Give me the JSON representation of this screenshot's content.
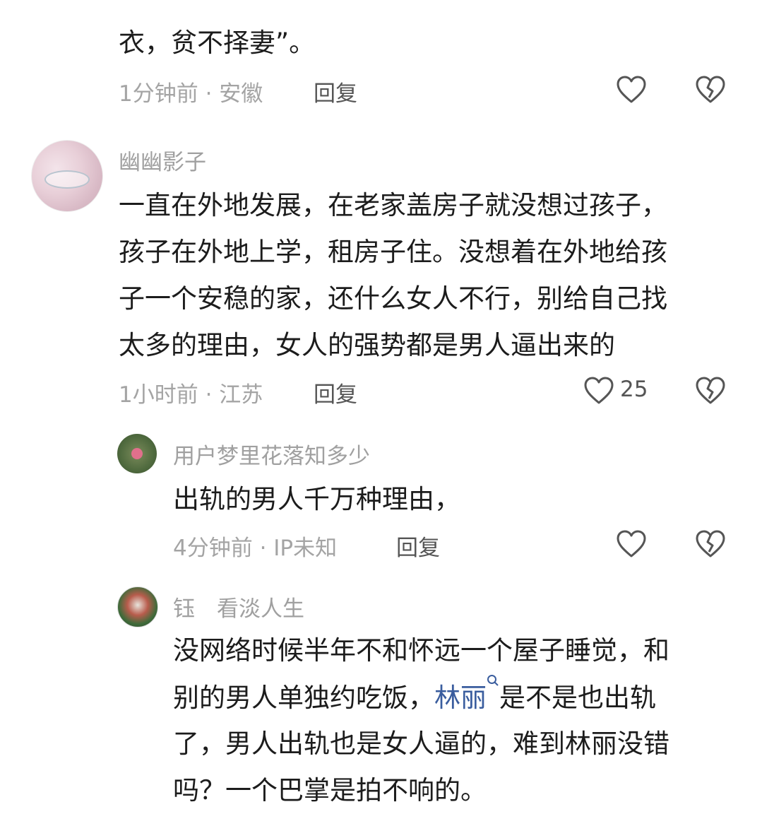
{
  "comments": [
    {
      "text_tail": "衣，贫不择妻”。",
      "time": "1分钟前 · 安徽",
      "reply": "回复"
    },
    {
      "username": "幽幽影子",
      "text_lines": [
        "一直在外地发展，在老家盖房子就没想过孩子，",
        "孩子在外地上学，租房子住。没想着在外地给孩",
        "子一个安稳的家，还什么女人不行，别给自己找",
        "太多的理由，女人的强势都是男人逼出来的"
      ],
      "time": "1小时前 · 江苏",
      "reply": "回复",
      "likes": "25"
    }
  ],
  "replies": [
    {
      "username": "用户梦里花落知多少",
      "text": "出轨的男人千万种理由，",
      "time": "4分钟前 · IP未知",
      "reply": "回复"
    },
    {
      "username": "钰　看淡人生",
      "line1": "没网络时候半年不和怀远一个屋子睡觉，和",
      "line2_pre": "别的男人单独约吃饭，",
      "line2_link": "林丽",
      "line2_post": "是不是也出轨",
      "line3": "了，男人出轨也是女人逼的，难到林丽没错",
      "line4": "吗？一个巴掌是拍不响的。"
    }
  ],
  "icons": {
    "like": "heart-outline-icon",
    "dislike": "broken-heart-icon",
    "search": "search-icon"
  },
  "colors": {
    "link": "#3a5d9e",
    "meta": "#a4a4a4"
  }
}
